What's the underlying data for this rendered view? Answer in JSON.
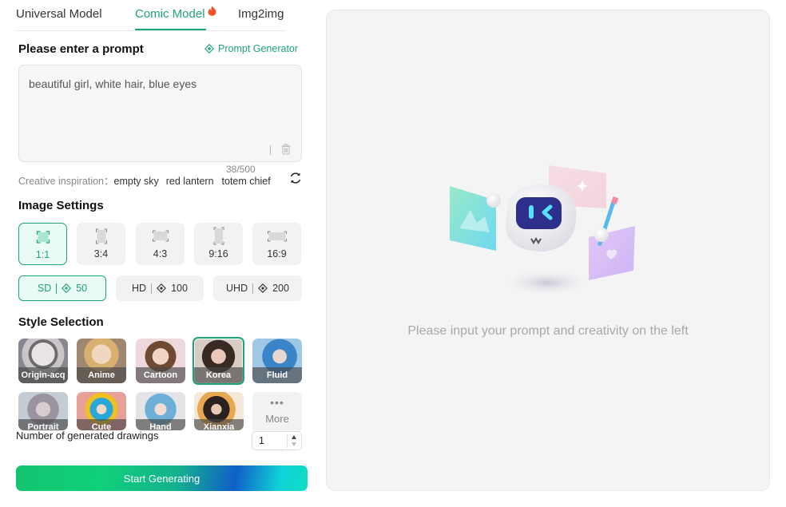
{
  "tabs": [
    {
      "label": "Universal Model",
      "active": false
    },
    {
      "label": "Comic Model",
      "active": true,
      "badge": "fire-icon"
    },
    {
      "label": "Img2img",
      "active": false
    }
  ],
  "prompt": {
    "heading": "Please enter a prompt",
    "generator_label": "Prompt Generator",
    "value": "beautiful girl, white hair, blue eyes",
    "counter": "38/500"
  },
  "inspiration": {
    "label": "Creative inspiration：",
    "chips": [
      "empty sky",
      "red lantern",
      "totem chief"
    ]
  },
  "image_settings": {
    "heading": "Image Settings",
    "ratios": [
      {
        "label": "1:1",
        "selected": true
      },
      {
        "label": "3:4",
        "selected": false
      },
      {
        "label": "4:3",
        "selected": false
      },
      {
        "label": "9:16",
        "selected": false
      },
      {
        "label": "16:9",
        "selected": false
      }
    ],
    "quality": [
      {
        "label": "SD",
        "cost": "50",
        "selected": true
      },
      {
        "label": "HD",
        "cost": "100",
        "selected": false
      },
      {
        "label": "UHD",
        "cost": "200",
        "selected": false
      }
    ]
  },
  "style_selection": {
    "heading": "Style Selection",
    "styles": [
      {
        "label": "Origin-acq",
        "selected": false
      },
      {
        "label": "Anime",
        "selected": false
      },
      {
        "label": "Cartoon",
        "selected": false
      },
      {
        "label": "Korea",
        "selected": true
      },
      {
        "label": "Fluid",
        "selected": false
      },
      {
        "label": "Portrait",
        "selected": false
      },
      {
        "label": "Cute",
        "selected": false
      },
      {
        "label": "Hand drawn",
        "selected": false
      },
      {
        "label": "Xianxia",
        "selected": false
      }
    ],
    "more_dots": "•••",
    "more_label": "More"
  },
  "drawings": {
    "label": "Number of generated drawings",
    "value": "1"
  },
  "generate_label": "Start Generating",
  "canvas": {
    "empty_text": "Please input your prompt and creativity on the left"
  },
  "colors": {
    "accent": "#1fa37a",
    "canvas_bg": "#f4f4f4"
  }
}
